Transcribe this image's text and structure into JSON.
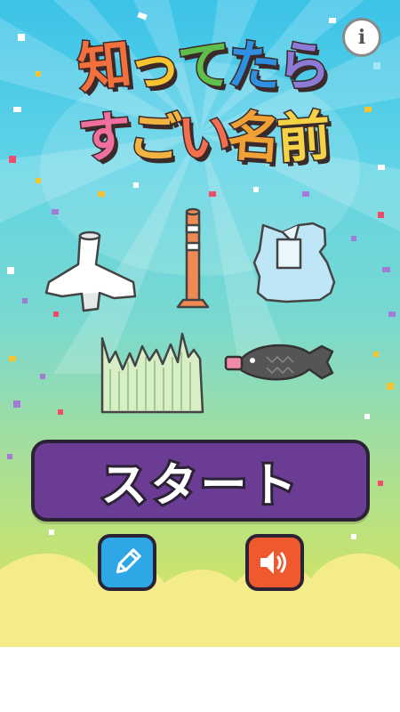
{
  "game": {
    "title_line1": [
      "知",
      "っ",
      "て",
      "た",
      "ら"
    ],
    "title_line2": [
      "す",
      "ご",
      "い",
      "名",
      "前"
    ],
    "title_colors_line1": [
      "#f2703d",
      "#f7c431",
      "#5fbf4a",
      "#2f8fe0",
      "#8d7ad6"
    ],
    "title_colors_line2": [
      "#ef6f9e",
      "#f2b441",
      "#f36d4f",
      "#f0a136",
      "#f6d247"
    ],
    "info_label": "i",
    "start_label": "スタート"
  },
  "icons": {
    "info": "info-icon",
    "edit": "pencil-icon",
    "sound": "speaker-icon"
  },
  "colors": {
    "start_bg": "#6a3c93",
    "edit_bg": "#2da7e6",
    "sound_bg": "#ee5a2e"
  },
  "illustrations": [
    "tetrapod",
    "delineator-pole",
    "bread-clip",
    "grass-separator",
    "fish-soy-sauce-bottle"
  ]
}
